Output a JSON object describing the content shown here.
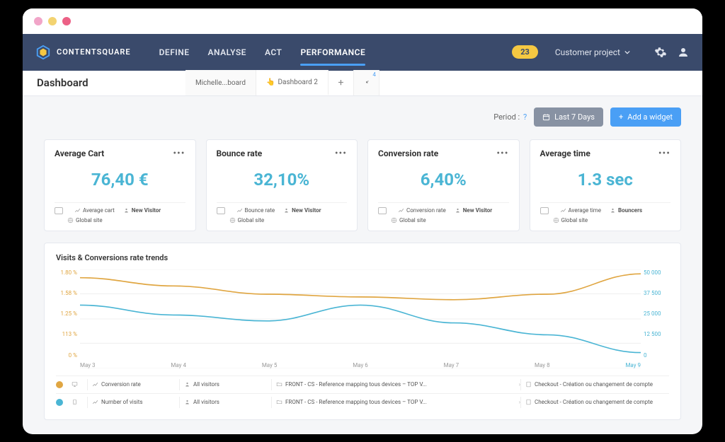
{
  "brand": "CONTENTSQUARE",
  "nav": {
    "items": [
      "DEFINE",
      "ANALYSE",
      "ACT",
      "PERFORMANCE"
    ],
    "active_index": 3,
    "badge": "23",
    "project_label": "Customer project"
  },
  "dash": {
    "title": "Dashboard",
    "tabs": [
      {
        "label": "Michelle...board"
      },
      {
        "label": "Dashboard 2",
        "icon": "👆"
      }
    ],
    "collapse_count": "4"
  },
  "toolbar": {
    "period_label": "Period :",
    "period_button": "Last 7 Days",
    "add_widget": "Add a widget"
  },
  "cards": [
    {
      "title": "Average Cart",
      "value": "76,40 €",
      "metric": "Average cart",
      "audience": "New Visitor",
      "scope": "Global site"
    },
    {
      "title": "Bounce rate",
      "value": "32,10%",
      "metric": "Bounce rate",
      "audience": "New Visitor",
      "scope": "Global site"
    },
    {
      "title": "Conversion rate",
      "value": "6,40%",
      "metric": "Conversion rate",
      "audience": "New Visitor",
      "scope": "Global site"
    },
    {
      "title": "Average time",
      "value": "1.3 sec",
      "metric": "Average time",
      "audience": "Bouncers",
      "scope": "Global site"
    }
  ],
  "chart_data": {
    "type": "line",
    "title": "Visits & Conversions rate trends",
    "categories": [
      "May 3",
      "May 4",
      "May 5",
      "May 6",
      "May 7",
      "May 8",
      "May 9"
    ],
    "y_left": {
      "ticks": [
        "1.80 %",
        "1.58 %",
        "1.25 %",
        "113 %",
        "0 %"
      ],
      "range": [
        0,
        1.8
      ]
    },
    "y_right": {
      "ticks": [
        "50 000",
        "37 500",
        "25 000",
        "12 500",
        "0"
      ],
      "range": [
        0,
        50000
      ]
    },
    "series": [
      {
        "name": "Conversion rate",
        "axis": "left",
        "color": "#e0a642",
        "values": [
          1.65,
          1.5,
          1.35,
          1.3,
          1.25,
          1.35,
          1.72
        ]
      },
      {
        "name": "Number of visits",
        "axis": "right",
        "color": "#4ab5d4",
        "values": [
          32000,
          27000,
          24000,
          32000,
          23000,
          17000,
          8000
        ]
      }
    ],
    "legend_rows": [
      {
        "color": "yellow",
        "device": "desktop",
        "metric": "Conversion rate",
        "visitors": "All visitors",
        "mapping": "FRONT - CS - Reference mapping tous devices – TOP V...",
        "checkout": "Checkout - Création ou changement de compte"
      },
      {
        "color": "blue",
        "device": "mobile",
        "metric": "Number of visits",
        "visitors": "All visitors",
        "mapping": "FRONT - CS - Reference mapping tous devices – TOP V...",
        "checkout": "Checkout - Création ou changement de compte"
      }
    ]
  }
}
